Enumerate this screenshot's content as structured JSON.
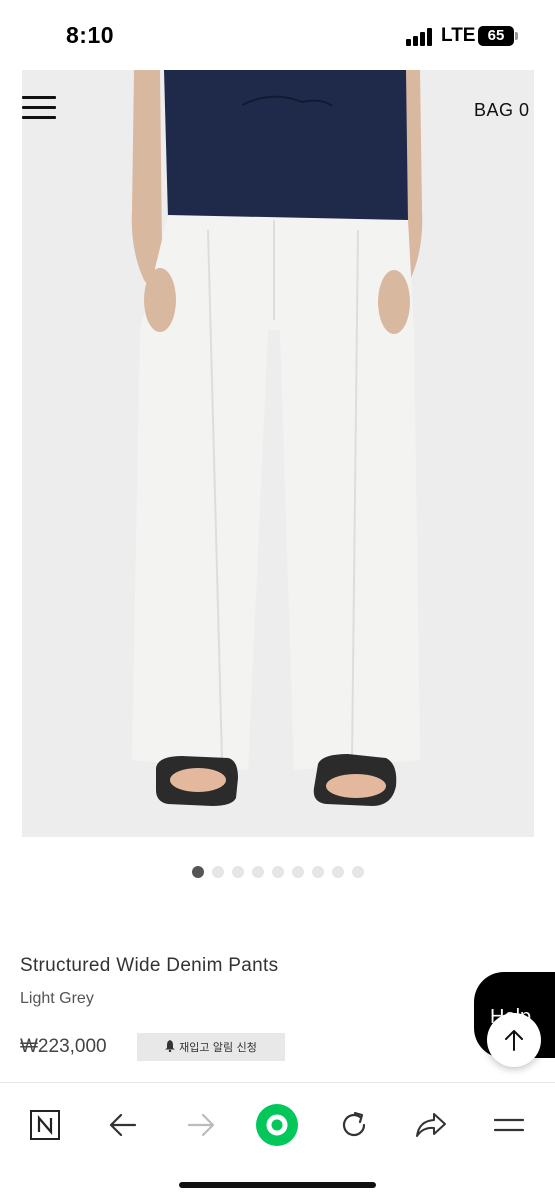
{
  "status_bar": {
    "time": "8:10",
    "network": "LTE",
    "battery": "65"
  },
  "header": {
    "bag_label": "BAG 0"
  },
  "carousel": {
    "count": 9,
    "active_index": 0
  },
  "product": {
    "name": "Structured Wide Denim Pants",
    "color": "Light Grey",
    "price": "₩223,000",
    "restock_label": "재입고 알림 신청"
  },
  "help_widget": {
    "label": "Help"
  },
  "browser_toolbar": {
    "items": [
      "naver-home",
      "back",
      "forward",
      "green-dot",
      "reload",
      "share",
      "menu"
    ],
    "green_color": "#03c75a"
  }
}
